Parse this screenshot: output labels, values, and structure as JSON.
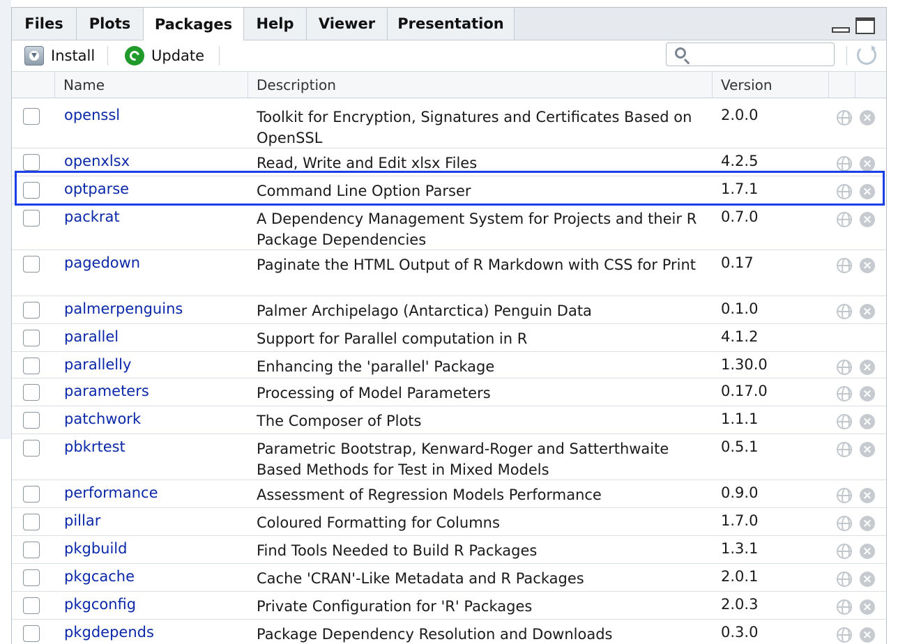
{
  "tabs": [
    {
      "label": "Files"
    },
    {
      "label": "Plots"
    },
    {
      "label": "Packages"
    },
    {
      "label": "Help"
    },
    {
      "label": "Viewer"
    },
    {
      "label": "Presentation"
    }
  ],
  "active_tab": "Packages",
  "toolbar": {
    "install_label": "Install",
    "update_label": "Update",
    "search_placeholder": ""
  },
  "table": {
    "headers": {
      "name": "Name",
      "description": "Description",
      "version": "Version"
    },
    "rows": [
      {
        "name": "openssl",
        "description": "Toolkit for Encryption, Signatures and Certificates Based on OpenSSL",
        "version": "2.0.0",
        "has_actions": true
      },
      {
        "name": "openxlsx",
        "description": "Read, Write and Edit xlsx Files",
        "version": "4.2.5",
        "has_actions": true
      },
      {
        "name": "optparse",
        "description": "Command Line Option Parser",
        "version": "1.7.1",
        "has_actions": true
      },
      {
        "name": "packrat",
        "description": "A Dependency Management System for Projects and their R Package Dependencies",
        "version": "0.7.0",
        "has_actions": true
      },
      {
        "name": "pagedown",
        "description": "Paginate the HTML Output of R Markdown with CSS for Print",
        "version": "0.17",
        "has_actions": true
      },
      {
        "name": "palmerpenguins",
        "description": "Palmer Archipelago (Antarctica) Penguin Data",
        "version": "0.1.0",
        "has_actions": true
      },
      {
        "name": "parallel",
        "description": "Support for Parallel computation in R",
        "version": "4.1.2",
        "has_actions": false
      },
      {
        "name": "parallelly",
        "description": "Enhancing the 'parallel' Package",
        "version": "1.30.0",
        "has_actions": true
      },
      {
        "name": "parameters",
        "description": "Processing of Model Parameters",
        "version": "0.17.0",
        "has_actions": true
      },
      {
        "name": "patchwork",
        "description": "The Composer of Plots",
        "version": "1.1.1",
        "has_actions": true
      },
      {
        "name": "pbkrtest",
        "description": "Parametric Bootstrap, Kenward-Roger and Satterthwaite Based Methods for Test in Mixed Models",
        "version": "0.5.1",
        "has_actions": true
      },
      {
        "name": "performance",
        "description": "Assessment of Regression Models Performance",
        "version": "0.9.0",
        "has_actions": true
      },
      {
        "name": "pillar",
        "description": "Coloured Formatting for Columns",
        "version": "1.7.0",
        "has_actions": true
      },
      {
        "name": "pkgbuild",
        "description": "Find Tools Needed to Build R Packages",
        "version": "1.3.1",
        "has_actions": true
      },
      {
        "name": "pkgcache",
        "description": "Cache 'CRAN'-Like Metadata and R Packages",
        "version": "2.0.1",
        "has_actions": true
      },
      {
        "name": "pkgconfig",
        "description": "Private Configuration for 'R' Packages",
        "version": "2.0.3",
        "has_actions": true
      },
      {
        "name": "pkgdepends",
        "description": "Package Dependency Resolution and Downloads",
        "version": "0.3.0",
        "has_actions": true
      }
    ]
  },
  "highlighted_row": "optparse",
  "colors": {
    "link": "#0a28a8",
    "highlight": "#1a3fe6",
    "update_green": "#1f9a2b"
  }
}
